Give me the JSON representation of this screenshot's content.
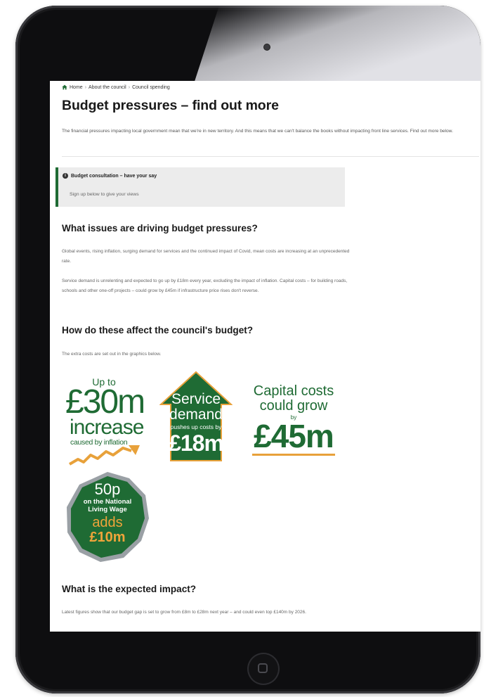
{
  "breadcrumb": {
    "home": "Home",
    "about": "About the council",
    "spending": "Council spending"
  },
  "page_title": "Budget pressures – find out more",
  "intro": "The financial pressures impacting local government mean that we're in new territory. And this means that we can't balance the books without impacting front line services. Find out more below.",
  "notice": {
    "title": "Budget consultation – have your say",
    "text": "Sign up below to give your views"
  },
  "sections": {
    "issues_heading": "What issues are driving budget pressures?",
    "issues_p1": "Global events, rising inflation, surging demand for services and the continued impact of Covid, mean costs are increasing at an unprecedented rate.",
    "issues_p2": "Service demand is unrelenting and expected to go up by £18m every year, excluding the impact of inflation. Capital costs – for building roads, schools and other one-off projects – could grow by £45m if infrastructure price rises don't reverse.",
    "affect_heading": "How do these affect the council's budget?",
    "affect_p": "The extra costs are set out in the graphics below.",
    "impact_heading": "What is the expected impact?",
    "impact_p": "Latest figures show that our budget gap is set to grow from £8m to £28m next year – and could even top £140m by 2026."
  },
  "graphics": {
    "inflation": {
      "up_to": "Up to",
      "amount": "£30m",
      "label": "increase",
      "caption": "caused by inflation"
    },
    "service": {
      "line1": "Service",
      "line2": "demand",
      "caption": "pushes up costs by",
      "amount": "£18m"
    },
    "capital": {
      "line1": "Capital costs",
      "line2": "could grow",
      "by": "by",
      "amount": "£45m"
    },
    "wage": {
      "amount": "50p",
      "line1": "on the National",
      "line2": "Living Wage",
      "adds": "adds",
      "total": "£10m"
    }
  },
  "colors": {
    "accent_green": "#1f6b34",
    "accent_orange": "#e8a13a",
    "notice_bg": "#ececec"
  }
}
